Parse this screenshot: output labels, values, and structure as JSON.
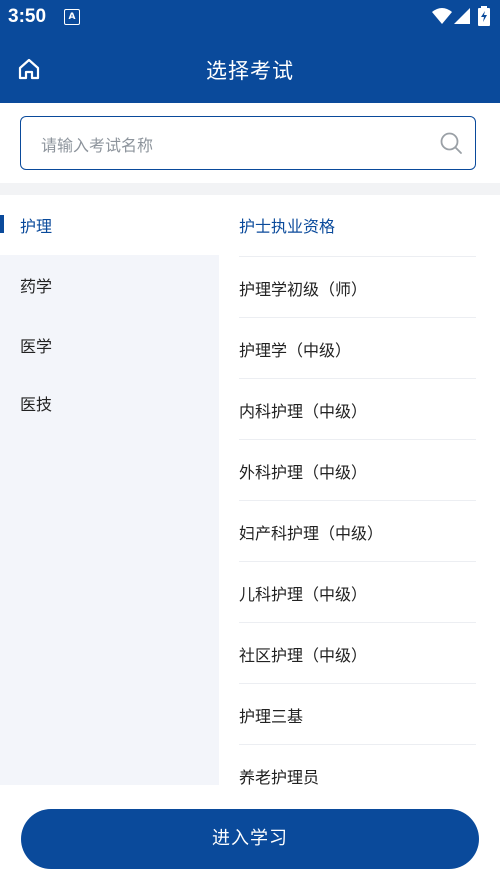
{
  "status_bar": {
    "time": "3:50",
    "app_badge": "A"
  },
  "header": {
    "title": "选择考试"
  },
  "search": {
    "placeholder": "请输入考试名称"
  },
  "categories": [
    {
      "label": "护理",
      "active": true
    },
    {
      "label": "药学"
    },
    {
      "label": "医学"
    },
    {
      "label": "医技"
    }
  ],
  "exams": {
    "group_title": "护士执业资格",
    "items": [
      "护理学初级（师）",
      "护理学（中级）",
      "内科护理（中级）",
      "外科护理（中级）",
      "妇产科护理（中级）",
      "儿科护理（中级）",
      "社区护理（中级）",
      "护理三基",
      "养老护理员"
    ]
  },
  "footer": {
    "enter_label": "进入学习"
  },
  "colors": {
    "primary": "#0a4a9b",
    "sidebar_bg": "#f3f5fa",
    "text": "#222222"
  }
}
